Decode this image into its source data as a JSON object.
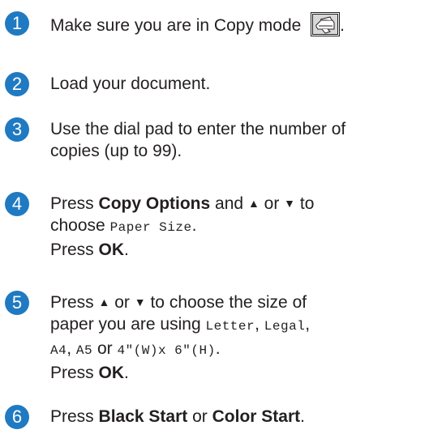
{
  "steps": [
    {
      "number": "1",
      "text_before": "Make sure you are in Copy mode",
      "text_after": ".",
      "icon": "copy-mode-button-icon"
    },
    {
      "number": "2",
      "text": "Load your document."
    },
    {
      "number": "3",
      "line1": "Use the dial pad to enter the number of",
      "line2": "copies (up to 99)."
    },
    {
      "number": "4",
      "press": "Press",
      "button_copy_options": "Copy Options",
      "and": "and",
      "up_arrow": "▲",
      "or": "or",
      "down_arrow": "▼",
      "to": "to",
      "choose": "choose",
      "menu_item": "Paper Size",
      "period": ".",
      "ok_prefix": "Press",
      "ok": "OK",
      "ok_period": "."
    },
    {
      "number": "5",
      "press": "Press",
      "up_arrow": "▲",
      "or": "or",
      "down_arrow": "▼",
      "to_choose": "to choose the size of",
      "paper_prefix": "paper you are using",
      "opt_letter": "Letter",
      "comma1": ",",
      "opt_legal": "Legal",
      "comma2": ",",
      "opt_a4": "A4",
      "comma3": ",",
      "opt_a5": "A5",
      "or2": "or",
      "opt_4x6": "4\"(W)x 6\"(H)",
      "period": ".",
      "ok_prefix": "Press",
      "ok": "OK",
      "ok_period": "."
    },
    {
      "number": "6",
      "press": "Press",
      "black_start": "Black Start",
      "or": "or",
      "color_start": "Color Start",
      "period": "."
    }
  ],
  "colors": {
    "step_number_bg": "#1f7ac2",
    "text": "#231f20"
  }
}
